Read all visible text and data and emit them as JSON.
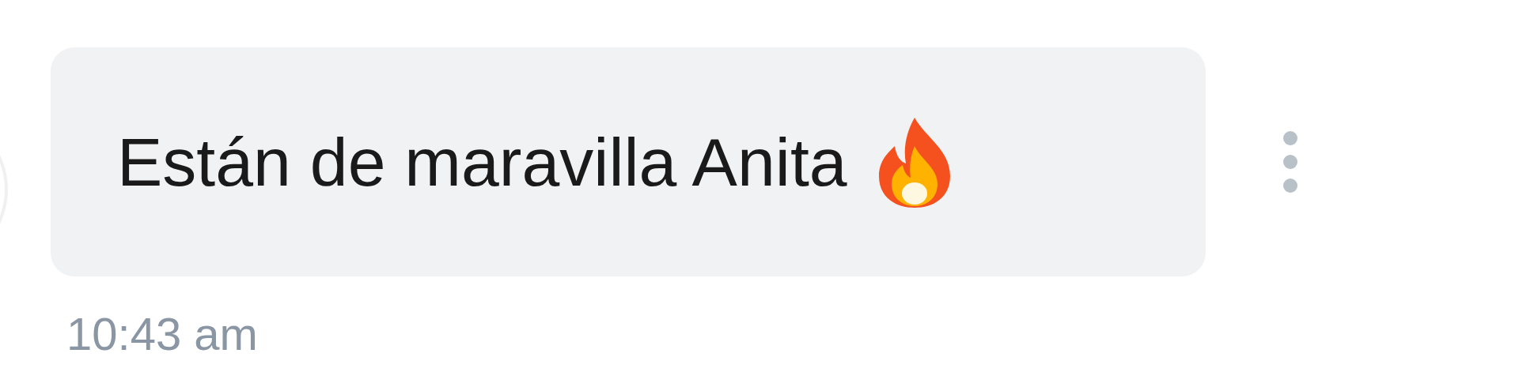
{
  "message": {
    "text": "Están de maravilla Anita",
    "time": "10:43 am"
  }
}
